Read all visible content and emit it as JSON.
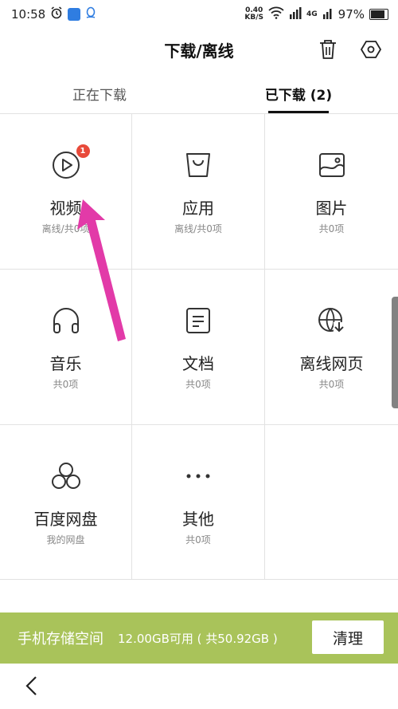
{
  "status_bar": {
    "time": "10:58",
    "speed_value": "0.40",
    "speed_unit": "KB/S",
    "net_type": "4G",
    "battery": "97%",
    "battery_level": 0.97
  },
  "header": {
    "title": "下载/离线"
  },
  "tabs": [
    {
      "label": "正在下载"
    },
    {
      "label": "已下载 (2)"
    }
  ],
  "grid": {
    "items": [
      {
        "name": "视频",
        "sub": "离线/共0项",
        "icon": "video-icon",
        "badge": "1"
      },
      {
        "name": "应用",
        "sub": "离线/共0项",
        "icon": "bag-icon"
      },
      {
        "name": "图片",
        "sub": "共0项",
        "icon": "image-icon"
      },
      {
        "name": "音乐",
        "sub": "共0项",
        "icon": "headphones-icon"
      },
      {
        "name": "文档",
        "sub": "共0项",
        "icon": "document-icon"
      },
      {
        "name": "离线网页",
        "sub": "共0项",
        "icon": "offline-web-icon"
      },
      {
        "name": "百度网盘",
        "sub": "我的网盘",
        "icon": "netdisk-icon"
      },
      {
        "name": "其他",
        "sub": "共0项",
        "icon": "more-icon"
      }
    ]
  },
  "storage": {
    "label": "手机存储空间",
    "available": "12.00GB可用 ( 共50.92GB )",
    "clear_label": "清理"
  },
  "colors": {
    "storage_bar": "#a9c35a",
    "badge": "#e84a3a",
    "annotation_arrow": "#e23aa8"
  }
}
